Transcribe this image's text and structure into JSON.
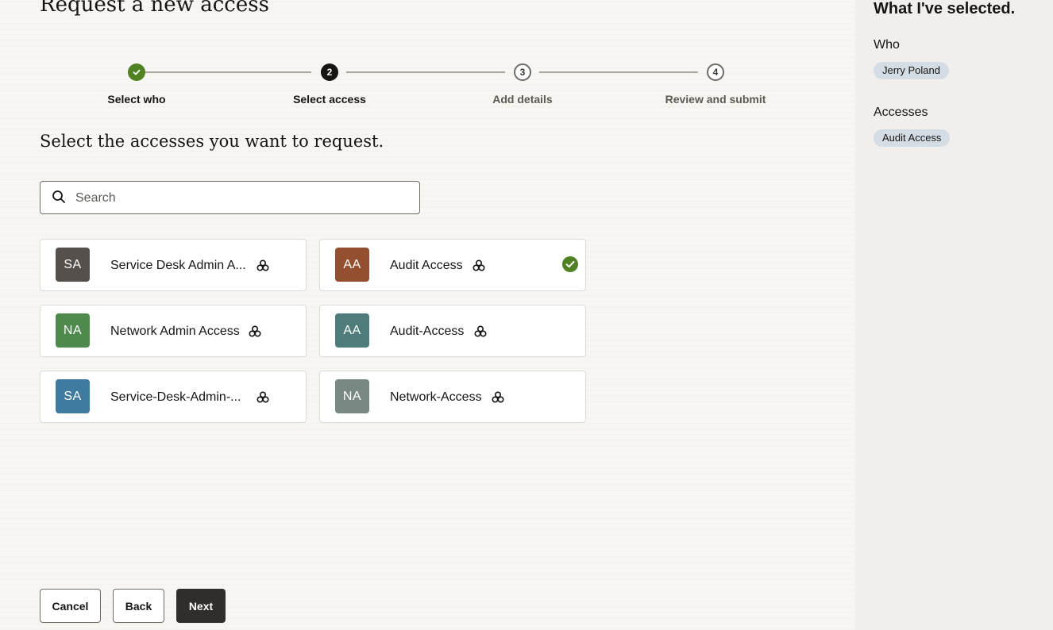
{
  "page": {
    "title": "Request a new access"
  },
  "stepper": {
    "steps": [
      {
        "label": "Select who",
        "status": "done",
        "number": "1"
      },
      {
        "label": "Select access",
        "status": "current",
        "number": "2"
      },
      {
        "label": "Add details",
        "status": "todo",
        "number": "3"
      },
      {
        "label": "Review and submit",
        "status": "todo",
        "number": "4"
      }
    ]
  },
  "main": {
    "section_title": "Select the accesses you want to request.",
    "search": {
      "placeholder": "Search",
      "value": ""
    },
    "cards": [
      {
        "initials": "SA",
        "title": "Service Desk Admin A...",
        "color": "#55504c",
        "selected": false,
        "icon": "role-bundle-icon"
      },
      {
        "initials": "AA",
        "title": "Audit Access",
        "color": "#94502e",
        "selected": true,
        "icon": "role-bundle-icon"
      },
      {
        "initials": "NA",
        "title": "Network Admin Access",
        "color": "#4e8a4e",
        "selected": false,
        "icon": "role-bundle-icon"
      },
      {
        "initials": "AA",
        "title": "Audit-Access",
        "color": "#4d7c7a",
        "selected": false,
        "icon": "role-bundle-icon"
      },
      {
        "initials": "SA",
        "title": "Service-Desk-Admin-...",
        "color": "#3f7aa0",
        "selected": false,
        "icon": "role-bundle-icon"
      },
      {
        "initials": "NA",
        "title": "Network-Access",
        "color": "#7a8884",
        "selected": false,
        "icon": "role-bundle-icon"
      }
    ]
  },
  "footer": {
    "cancel_label": "Cancel",
    "back_label": "Back",
    "next_label": "Next"
  },
  "sidebar": {
    "title": "What I've selected.",
    "who_label": "Who",
    "who_values": [
      "Jerry Poland"
    ],
    "accesses_label": "Accesses",
    "accesses_values": [
      "Audit Access"
    ]
  },
  "colors": {
    "success": "#508223",
    "primary_button": "#312d2a",
    "chip": "#d4dde3",
    "sidebar_bg": "#f1efed"
  }
}
